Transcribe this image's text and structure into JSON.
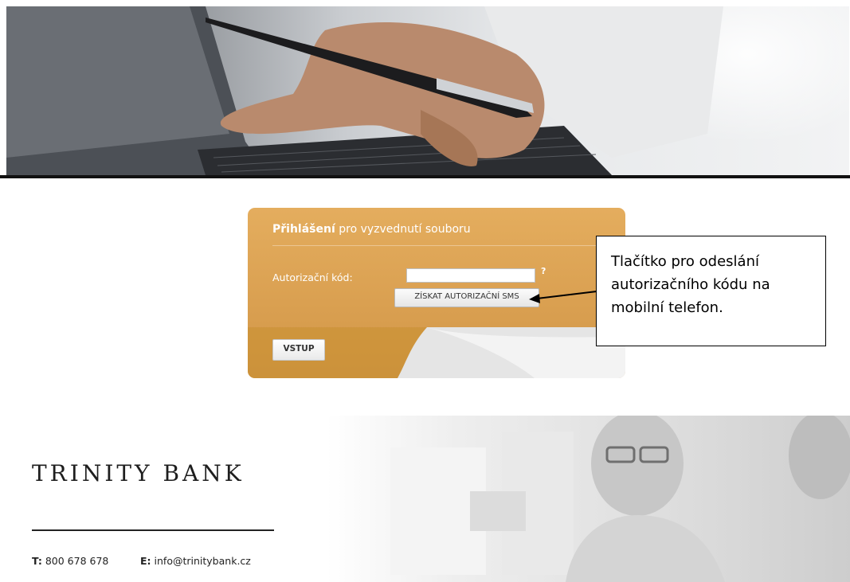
{
  "login": {
    "title_bold": "Přihlášení",
    "title_rest": " pro vyzvednutí souboru",
    "code_label": "Autorizační kód:",
    "code_value": "",
    "help_mark": "?",
    "sms_button": "ZÍSKAT AUTORIZAČNÍ SMS",
    "submit_button": "VSTUP"
  },
  "callout": {
    "lines": [
      "Tlačítko pro odeslání",
      "autorizačního kódu na",
      "mobilní telefon."
    ]
  },
  "footer": {
    "brand": "TRINITY BANK",
    "phone_label": "T:",
    "phone": "800 678 678",
    "email_label": "E:",
    "email": "info@trinitybank.cz"
  },
  "colors": {
    "panel": "#dca352",
    "text_light": "#ffffff",
    "button": "#eeeeee"
  },
  "icons": {
    "help": "question-mark-icon",
    "arrow": "left-arrow-icon"
  }
}
